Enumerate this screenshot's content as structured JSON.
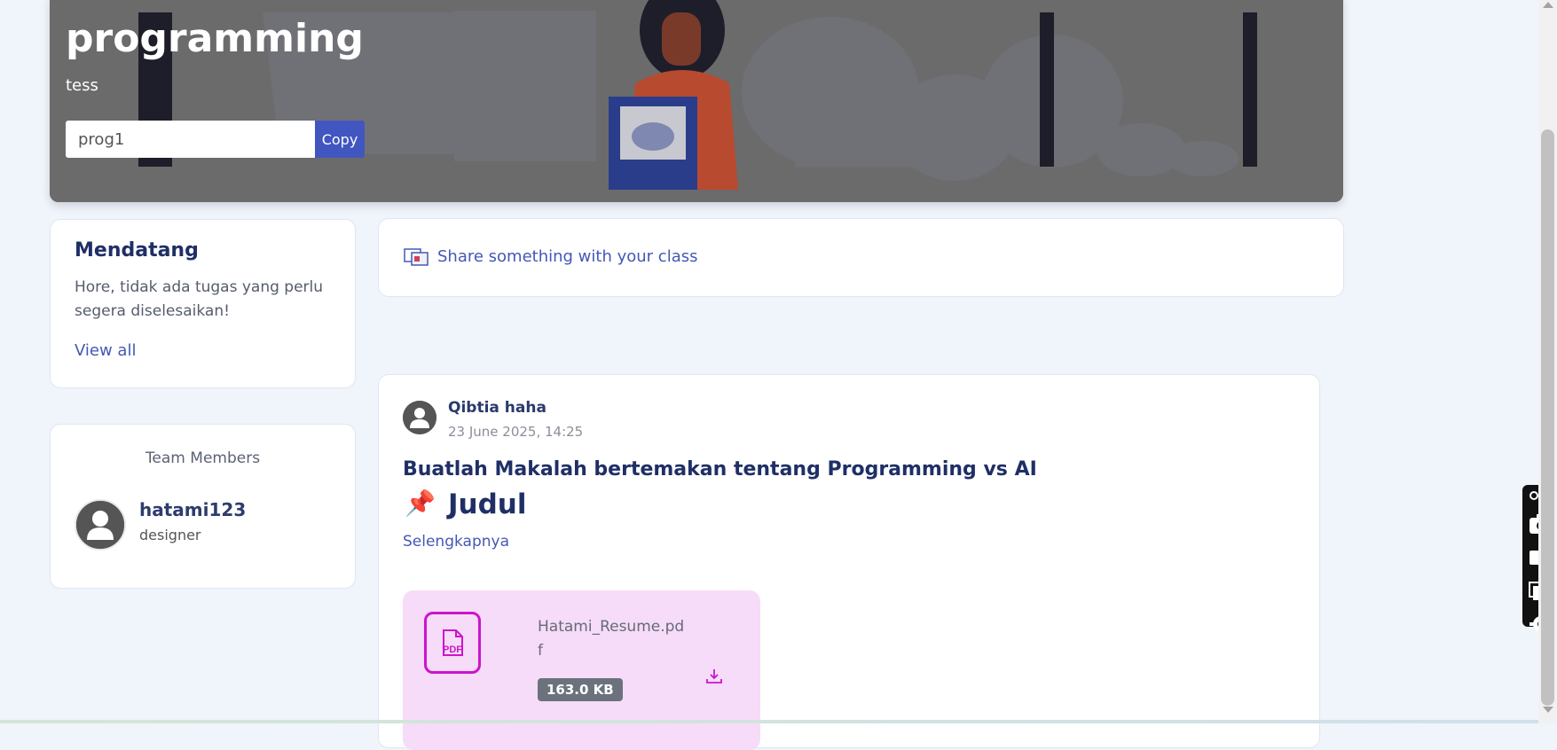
{
  "banner": {
    "class_name": "programming",
    "description": "tess",
    "class_code": "prog1",
    "copy_label": "Copy"
  },
  "upcoming": {
    "title": "Mendatang",
    "message": "Hore, tidak ada tugas yang perlu segera diselesaikan!",
    "view_all": "View all"
  },
  "team": {
    "title": "Team Members",
    "members": [
      {
        "name": "hatami123",
        "role": "designer"
      }
    ]
  },
  "share": {
    "label": "Share something with your class"
  },
  "post": {
    "author": "Qibtia haha",
    "time": "23 June 2025, 14:25",
    "title": "Buatlah Makalah bertemakan tentang Programming vs AI",
    "pin_icon": "📌",
    "heading": "Judul",
    "more": "Selengkapnya",
    "attachment": {
      "file_name": "Hatami_Resume.pdf",
      "size": "163.0 KB",
      "type_label": "PDF",
      "accent": "#cc14cc",
      "background": "#f6dcf8"
    }
  },
  "colors": {
    "primary": "#4256c0",
    "heading": "#1f2f66",
    "page_bg": "#f0f4fb",
    "banner_bg": "#6b6b6b"
  }
}
